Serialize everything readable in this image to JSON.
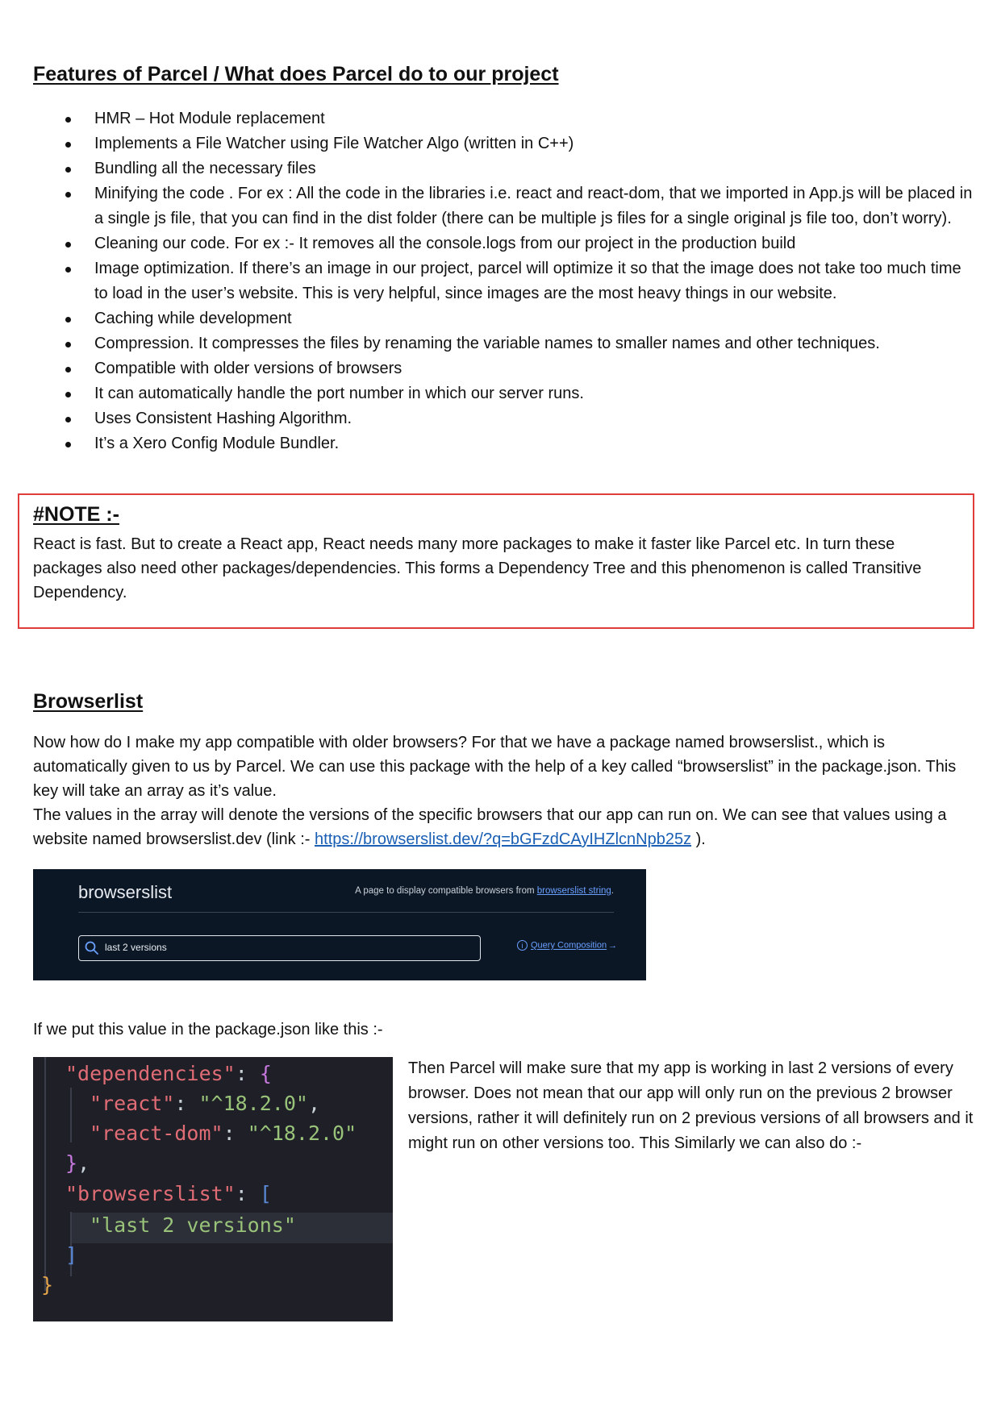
{
  "features": {
    "heading": "Features of Parcel / What does Parcel do to our project",
    "items": [
      "HMR – Hot Module replacement",
      "Implements a File Watcher using File Watcher Algo (written in C++)",
      "Bundling all the necessary files",
      "Minifying the code . For ex : All the code in the libraries i.e. react and react-dom, that we imported in App.js will be placed in a single js file, that you can find in the dist folder (there can be multiple js files for a single original js file too, don’t worry).",
      "Cleaning our code. For ex :- It removes all the console.logs from our project in the production build",
      "Image optimization. If there’s an image in our project, parcel will optimize it so that the image does not take too much time to load in the user’s website. This is very helpful, since images are the most heavy things in our website.",
      "Caching while development",
      "Compression. It compresses the files by renaming the variable names to smaller names and other techniques.",
      "Compatible with older versions of browsers",
      "It can automatically handle the port number in which our server runs.",
      "Uses Consistent Hashing Algorithm.",
      "It’s a Xero Config Module Bundler."
    ]
  },
  "note": {
    "title": "#NOTE :-",
    "text": "React is fast. But to create a React app, React needs many more packages to make it faster like Parcel etc. In turn these packages also need other packages/dependencies. This forms a Dependency Tree and this phenomenon is called Transitive Dependency."
  },
  "browserlist": {
    "heading": "Browserlist",
    "para1": "Now how do I make my app compatible with older browsers? For that we have a package named browserslist., which is automatically given to us by Parcel. We can use this package with the help of a key called “browserslist” in the package.json. This key will take an array as it’s value.",
    "para2_before": "The values in the array will denote the versions of the specific browsers that our app can run on. We can see that values using a website named browserslist.dev (link :- ",
    "para2_link": "https://browserslist.dev/?q=bGFzdCAyIHZlcnNpb25z",
    "para2_after": " ).",
    "para3": "If we put this value in the package.json like this :-",
    "side_text": "Then Parcel will make sure that my app is working in last 2 versions of every browser. Does not mean that our app will only run on the previous 2 browser versions, rather it will definitely run on 2 previous versions of all browsers and it might run on other versions too. This  Similarly we can also do :-"
  },
  "site_screenshot": {
    "title": "browserslist",
    "tagline_before": "A page to display compatible browsers from ",
    "tagline_link": "browserslist string",
    "tagline_after": ".",
    "search_value": "last 2 versions",
    "query_link": "Query Composition",
    "bg_color": "#0c1726",
    "link_color": "#6aa0ff",
    "icons": [
      "search-icon",
      "info-icon",
      "arrow-right-icon"
    ]
  },
  "code": {
    "deps_key": "\"dependencies\"",
    "react_key": "\"react\"",
    "react_ver": "\"^18.2.0\"",
    "dom_key": "\"react-dom\"",
    "dom_ver": "\"^18.2.0\"",
    "bl_key": "\"browserslist\"",
    "bl_val": "\"last 2 versions\"",
    "bg_color": "#1e1f27"
  }
}
